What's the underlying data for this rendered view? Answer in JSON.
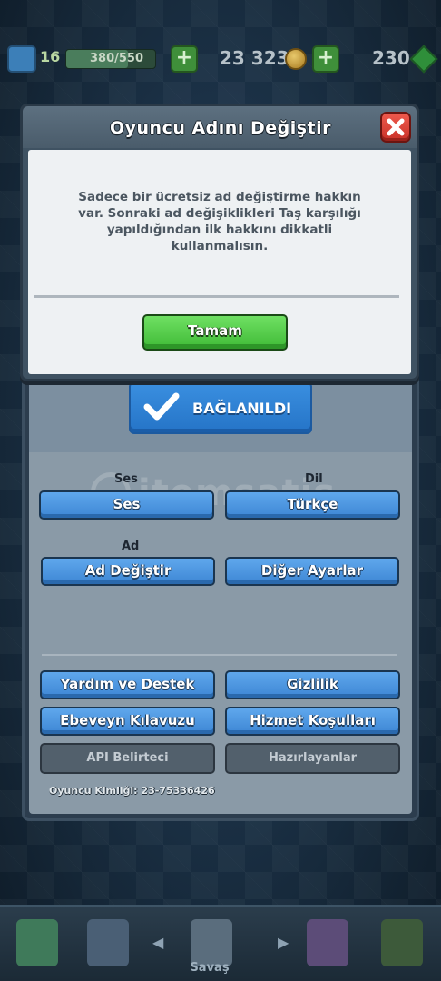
{
  "status_bar": {
    "level": "16",
    "xp_text": "380/550",
    "xp_fraction": 0.69,
    "gold": "23 323",
    "gems": "230"
  },
  "dialog": {
    "title": "Oyuncu Adını Değiştir",
    "message_lines": [
      "Sadece bir ücretsiz ad değiştirme hakkın",
      "var. Sonraki ad değişiklikleri Taş karşılığı",
      "yapıldığından ilk hakkını dikkatli",
      "kullanmalısın."
    ],
    "ok_label": "Tamam"
  },
  "settings": {
    "connected_label": "BAĞLANILDI",
    "sound_section": "Ses",
    "sound_button": "Ses",
    "language_section": "Dil",
    "language_button": "Türkçe",
    "name_section": "Ad",
    "change_name_button": "Ad Değiştir",
    "other_settings_button": "Diğer Ayarlar",
    "help_button": "Yardım ve Destek",
    "privacy_button": "Gizlilik",
    "parent_guide_button": "Ebeveyn Kılavuzu",
    "terms_button": "Hizmet Koşulları",
    "api_button": "API Belirteci",
    "credits_button": "Hazırlayanlar",
    "player_id": "Oyuncu Kimliği: 23-75336426"
  },
  "watermark": "itemsatis",
  "bottom_nav": {
    "battle_label": "Savaş"
  },
  "colors": {
    "accent_blue": "#3d86d4",
    "ok_green": "#3fba36",
    "close_red": "#c93128"
  }
}
